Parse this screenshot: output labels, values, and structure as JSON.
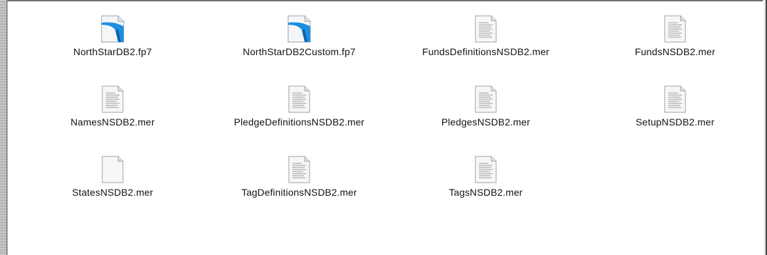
{
  "files": [
    {
      "name": "NorthStarDB2.fp7",
      "icon": "filemaker-document-icon"
    },
    {
      "name": "NorthStarDB2Custom.fp7",
      "icon": "filemaker-document-icon"
    },
    {
      "name": "FundsDefinitionsNSDB2.mer",
      "icon": "text-document-icon"
    },
    {
      "name": "FundsNSDB2.mer",
      "icon": "text-document-icon"
    },
    {
      "name": "NamesNSDB2.mer",
      "icon": "text-document-icon"
    },
    {
      "name": "PledgeDefinitionsNSDB2.mer",
      "icon": "text-document-icon"
    },
    {
      "name": "PledgesNSDB2.mer",
      "icon": "text-document-icon"
    },
    {
      "name": "SetupNSDB2.mer",
      "icon": "text-document-icon"
    },
    {
      "name": "StatesNSDB2.mer",
      "icon": "blank-document-icon"
    },
    {
      "name": "TagDefinitionsNSDB2.mer",
      "icon": "text-document-icon"
    },
    {
      "name": "TagsNSDB2.mer",
      "icon": "text-document-icon"
    }
  ],
  "colors": {
    "filemaker_blue": "#1e8fe0",
    "window_background": "#ffffff"
  }
}
